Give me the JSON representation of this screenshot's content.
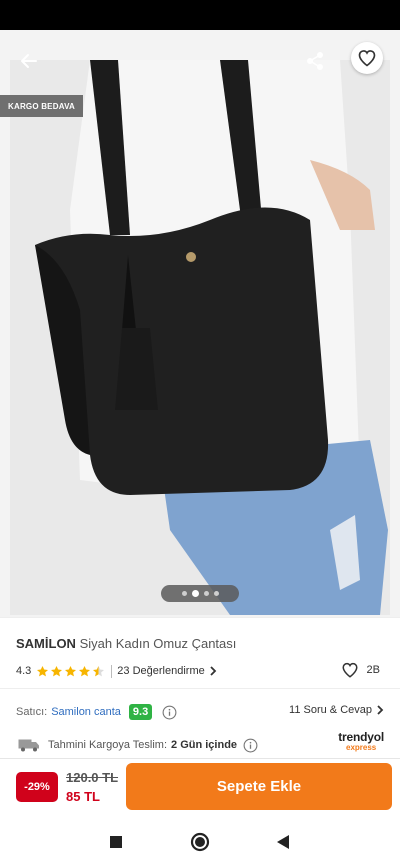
{
  "icons": {
    "back": "arrow-left-icon",
    "share": "share-icon",
    "favorite": "heart-icon",
    "star": "star-icon",
    "chevron": "chevron-right-icon",
    "info": "info-icon",
    "truck": "truck-icon",
    "nav_recent": "square-icon",
    "nav_home": "circle-icon",
    "nav_back": "triangle-back-icon"
  },
  "colors": {
    "accent": "#f27a1a",
    "discount": "#d0021b",
    "seller_score": "#2fb344",
    "seller_link": "#2f6dbf",
    "star": "#f7b500"
  },
  "hero": {
    "badge": "KARGO BEDAVA",
    "carousel_count": 4,
    "carousel_active": 1
  },
  "product": {
    "brand": "SAMİLON",
    "name": "Siyah Kadın Omuz Çantası",
    "rating": "4.3",
    "rating_value": 4.3,
    "reviews": "23 Değerlendirme",
    "favorites": "2B"
  },
  "seller": {
    "label": "Satıcı:",
    "name": "Samilon canta",
    "score": "9.3",
    "qa": "11 Soru & Cevap"
  },
  "shipping": {
    "label": "Tahmini Kargoya Teslim:",
    "days": "2 Gün içinde",
    "logo_main": "trendyol",
    "logo_sub": "express"
  },
  "purchase": {
    "discount": "-29%",
    "old_price": "120.0 TL",
    "new_price": "85 TL",
    "cart_button": "Sepete Ekle"
  }
}
